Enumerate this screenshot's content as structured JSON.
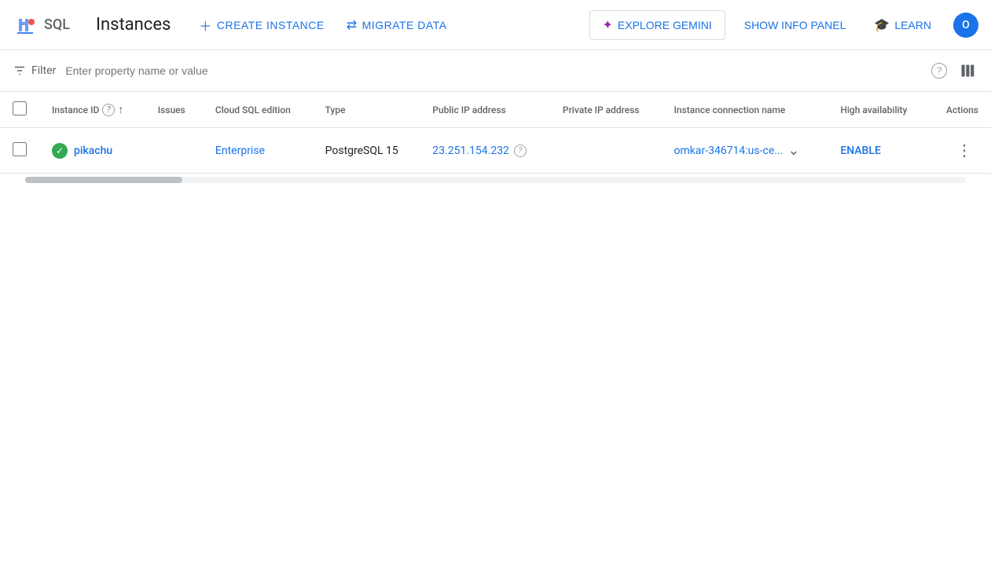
{
  "app": {
    "name": "SQL",
    "page_title": "Instances"
  },
  "toolbar": {
    "create_instance_label": "CREATE INSTANCE",
    "migrate_data_label": "MIGRATE DATA",
    "explore_gemini_label": "EXPLORE GEMINI",
    "show_info_panel_label": "SHOW INFO PANEL",
    "learn_label": "LEARN",
    "avatar_initials": "O"
  },
  "filter": {
    "label": "Filter",
    "placeholder": "Enter property name or value"
  },
  "table": {
    "columns": [
      "Instance ID",
      "Issues",
      "Cloud SQL edition",
      "Type",
      "Public IP address",
      "Private IP address",
      "Instance connection name",
      "High availability",
      "Actions"
    ],
    "rows": [
      {
        "status": "running",
        "instance_id": "pikachu",
        "issues": "",
        "cloud_sql_edition": "Enterprise",
        "type": "PostgreSQL 15",
        "public_ip": "23.251.154.232",
        "private_ip": "",
        "instance_connection_name": "omkar-346714:us-ce...",
        "high_availability": "ENABLE"
      }
    ]
  }
}
